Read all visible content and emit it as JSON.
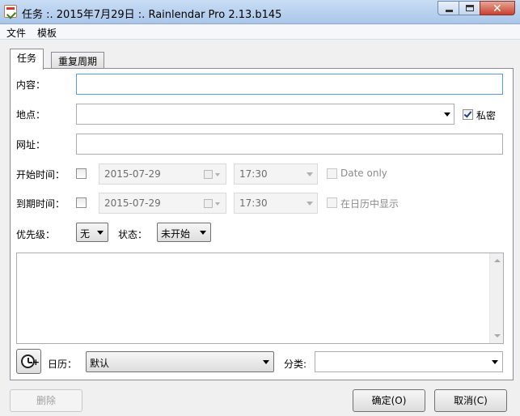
{
  "window": {
    "title": "任务 :. 2015年7月29日 :. Rainlendar Pro 2.13.b145"
  },
  "menu": [
    "文件",
    "模板"
  ],
  "tabs": [
    "任务",
    "重复周期"
  ],
  "form": {
    "content_label": "内容：",
    "content_value": "",
    "location_label": "地点：",
    "location_value": "",
    "private_label": "私密",
    "private_checked": true,
    "url_label": "网址：",
    "url_value": "",
    "start_label": "开始时间：",
    "start_date": "2015-07-29",
    "start_time": "17:30",
    "date_only_label": "Date only",
    "due_label": "到期时间：",
    "due_date": "2015-07-29",
    "due_time": "17:30",
    "show_in_calendar_label": "在日历中显示",
    "priority_label": "优先级：",
    "priority_value": "无",
    "status_label": "状态：",
    "status_value": "未开始",
    "notes_value": "",
    "calendar_label": "日历：",
    "calendar_value": "默认",
    "category_label": "分类:",
    "category_value": ""
  },
  "buttons": {
    "delete": "删除",
    "ok": "确定(O)",
    "cancel": "取消(C)"
  },
  "icons": [
    "app-icon",
    "minimize-icon",
    "maximize-icon",
    "close-icon",
    "calendar-icon",
    "alarm-clock-icon",
    "chevron-down-icon"
  ]
}
